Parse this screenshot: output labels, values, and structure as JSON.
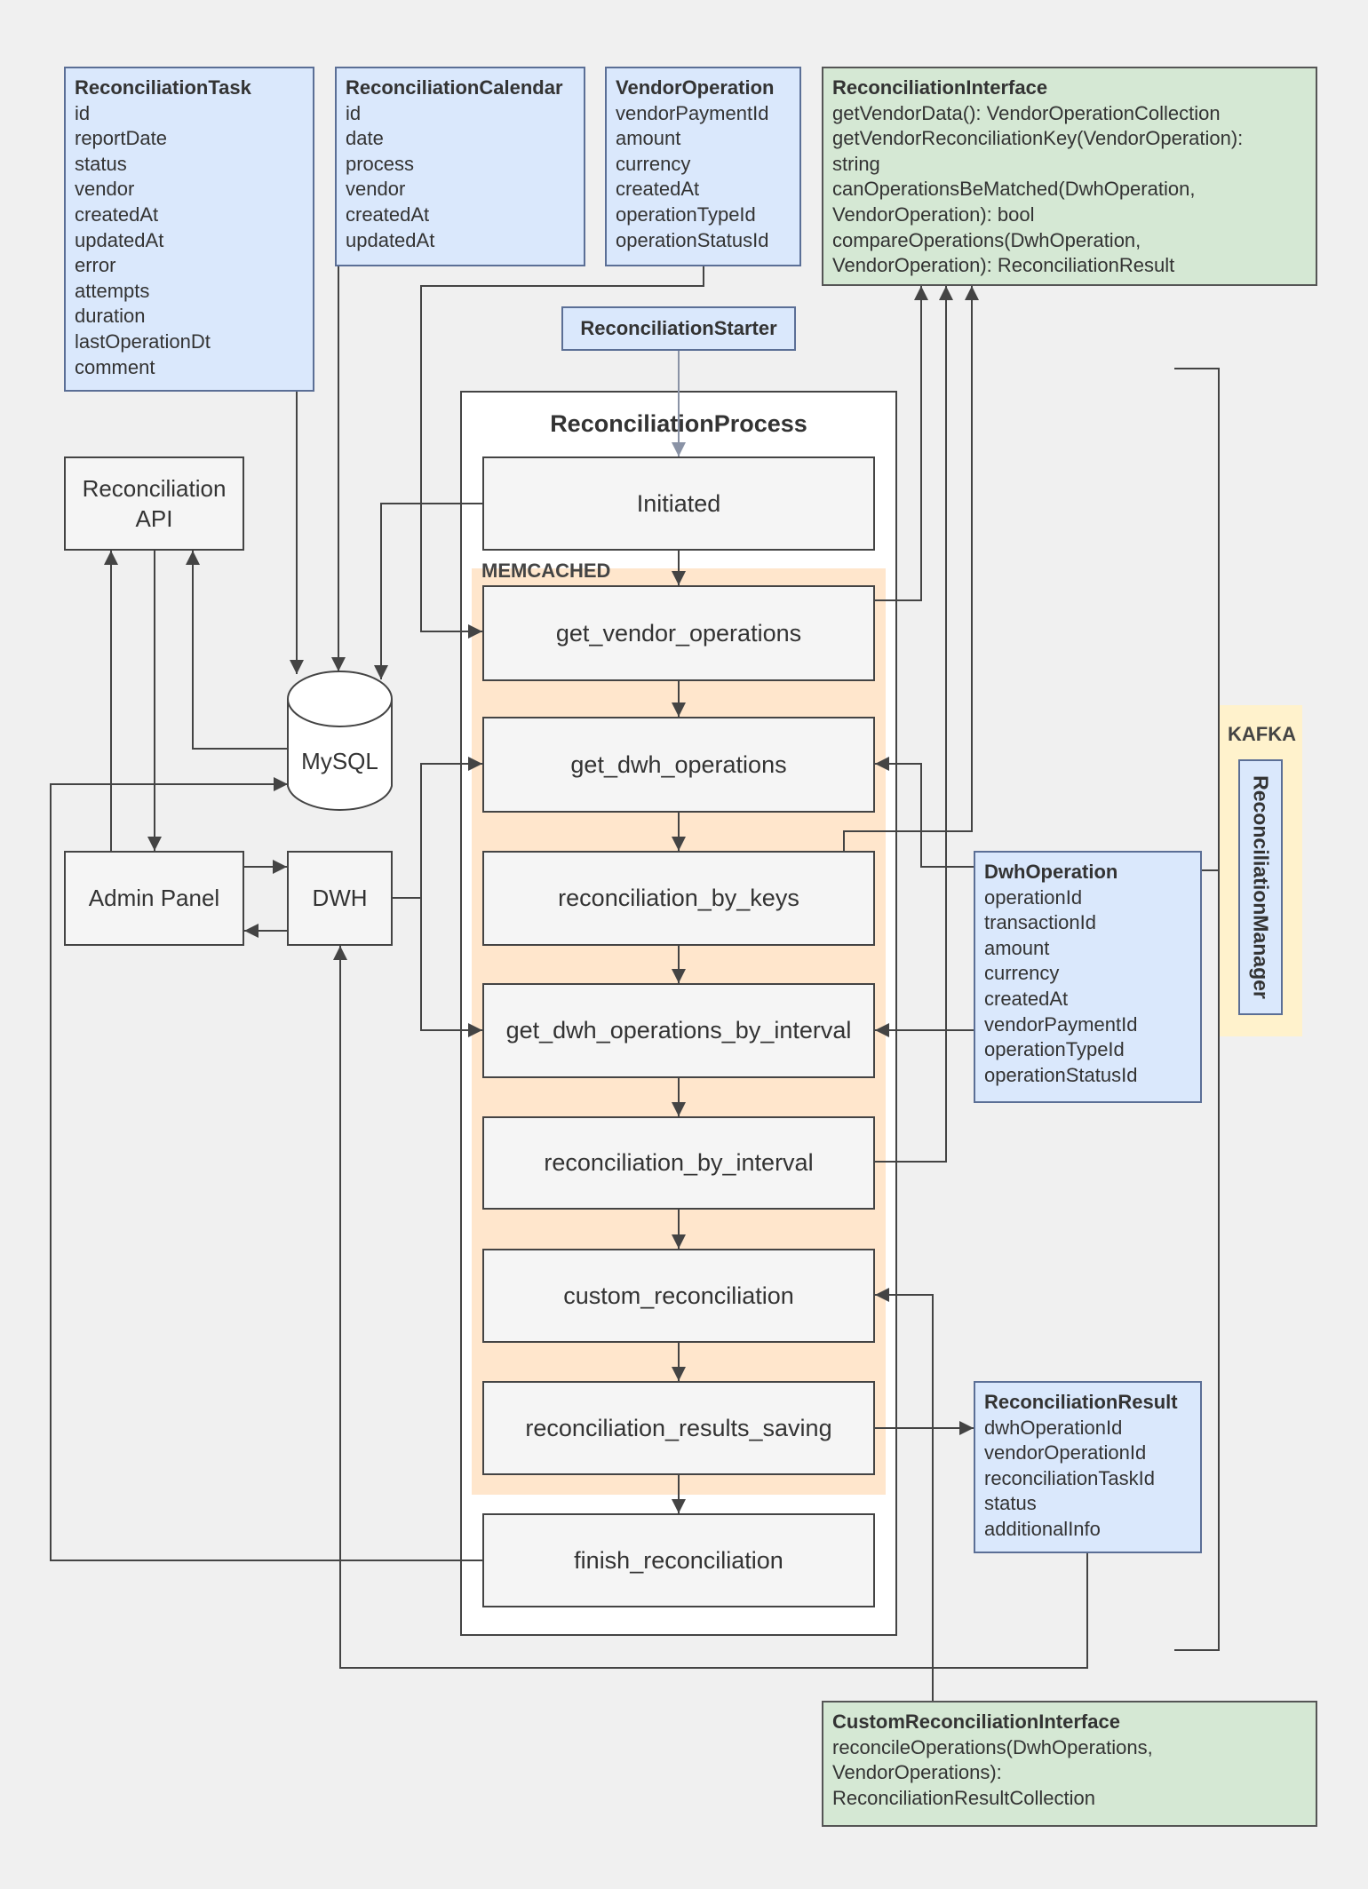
{
  "classes": {
    "task": {
      "title": "ReconciliationTask",
      "fields": [
        "id",
        "reportDate",
        "status",
        "vendor",
        "createdAt",
        "updatedAt",
        "error",
        "attempts",
        "duration",
        "lastOperationDt",
        "comment"
      ]
    },
    "calendar": {
      "title": "ReconciliationCalendar",
      "fields": [
        "id",
        "date",
        "process",
        "vendor",
        "createdAt",
        "updatedAt"
      ]
    },
    "vendor_operation": {
      "title": "VendorOperation",
      "fields": [
        "vendorPaymentId",
        "amount",
        "currency",
        "createdAt",
        "operationTypeId",
        "operationStatusId"
      ]
    },
    "interface": {
      "title": "ReconciliationInterface",
      "fields": [
        "getVendorData(): VendorOperationCollection",
        "getVendorReconciliationKey(VendorOperation):",
        "string",
        "canOperationsBeMatched(DwhOperation,",
        "VendorOperation): bool",
        "compareOperations(DwhOperation,",
        "VendorOperation): ReconciliationResult"
      ]
    },
    "starter": {
      "title": "ReconciliationStarter"
    },
    "dwh_operation": {
      "title": "DwhOperation",
      "fields": [
        "operationId",
        "transactionId",
        "amount",
        "currency",
        "createdAt",
        "vendorPaymentId",
        "operationTypeId",
        "operationStatusId"
      ]
    },
    "result": {
      "title": "ReconciliationResult",
      "fields": [
        "dwhOperationId",
        "vendorOperationId",
        "reconciliationTaskId",
        "status",
        "additionalInfo"
      ]
    },
    "custom_interface": {
      "title": "CustomReconciliationInterface",
      "fields": [
        "reconcileOperations(DwhOperations,",
        "VendorOperations):",
        "ReconciliationResultCollection"
      ]
    }
  },
  "process": {
    "title": "ReconciliationProcess",
    "memcached_label": "MEMCACHED",
    "steps": [
      "Initiated",
      "get_vendor_operations",
      "get_dwh_operations",
      "reconciliation_by_keys",
      "get_dwh_operations_by_interval",
      "reconciliation_by_interval",
      "custom_reconciliation",
      "reconciliation_results_saving",
      "finish_reconciliation"
    ]
  },
  "systems": {
    "api": "Reconciliation\nAPI",
    "api_line1": "Reconciliation",
    "api_line2": "API",
    "mysql": "MySQL",
    "admin": "Admin Panel",
    "dwh": "DWH"
  },
  "kafka": {
    "label": "KAFKA",
    "manager": "ReconciliationManager"
  },
  "colors": {
    "background": "#f0f0f0",
    "class_fill": "#dae8fc",
    "interface_fill": "#d5e8d4",
    "memcached_fill": "#ffe6cc",
    "kafka_fill": "#fff2cc",
    "line": "#444444"
  }
}
